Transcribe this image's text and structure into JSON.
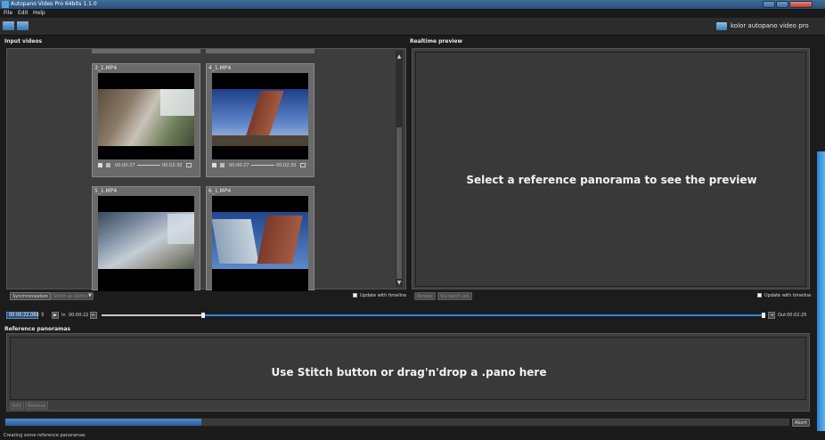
{
  "window": {
    "title": "Autopano Video Pro 64bits 1.1.0"
  },
  "menu": [
    "File",
    "Edit",
    "Help"
  ],
  "brand": {
    "text": "kolor autopano video pro"
  },
  "input_panel": {
    "title": "Input videos",
    "videos": [
      {
        "name": "3_1.MP4",
        "current": "00:00:27",
        "duration": "00:02:30"
      },
      {
        "name": "4_1.MP4",
        "current": "00:00:27",
        "duration": "00:02:30"
      },
      {
        "name": "5_1.MP4",
        "current": "",
        "duration": ""
      },
      {
        "name": "6_1.MP4",
        "current": "",
        "duration": ""
      }
    ],
    "sync_button": "Synchronization",
    "stitch_button": "Stitch as GoPro",
    "update_label": "Update with timeline"
  },
  "preview_panel": {
    "title": "Realtime preview",
    "message": "Select a reference panorama to see the preview",
    "render_button": "Render",
    "batch_button": "Via batch job",
    "update_label": "Update with timeline"
  },
  "timeline": {
    "current": "00:00:22,060",
    "in_label": "In",
    "in_time": "00:00:22",
    "out_label": "Out",
    "out_time": "00:02:25"
  },
  "reference_panel": {
    "title": "Reference panoramas",
    "message": "Use Stitch button or drag'n'drop a .pano here",
    "edit_button": "Edit",
    "remove_button": "Remove"
  },
  "progress": {
    "fraction": 0.25,
    "abort_label": "Abort"
  },
  "status": {
    "text": "Creating some reference panoramas"
  }
}
